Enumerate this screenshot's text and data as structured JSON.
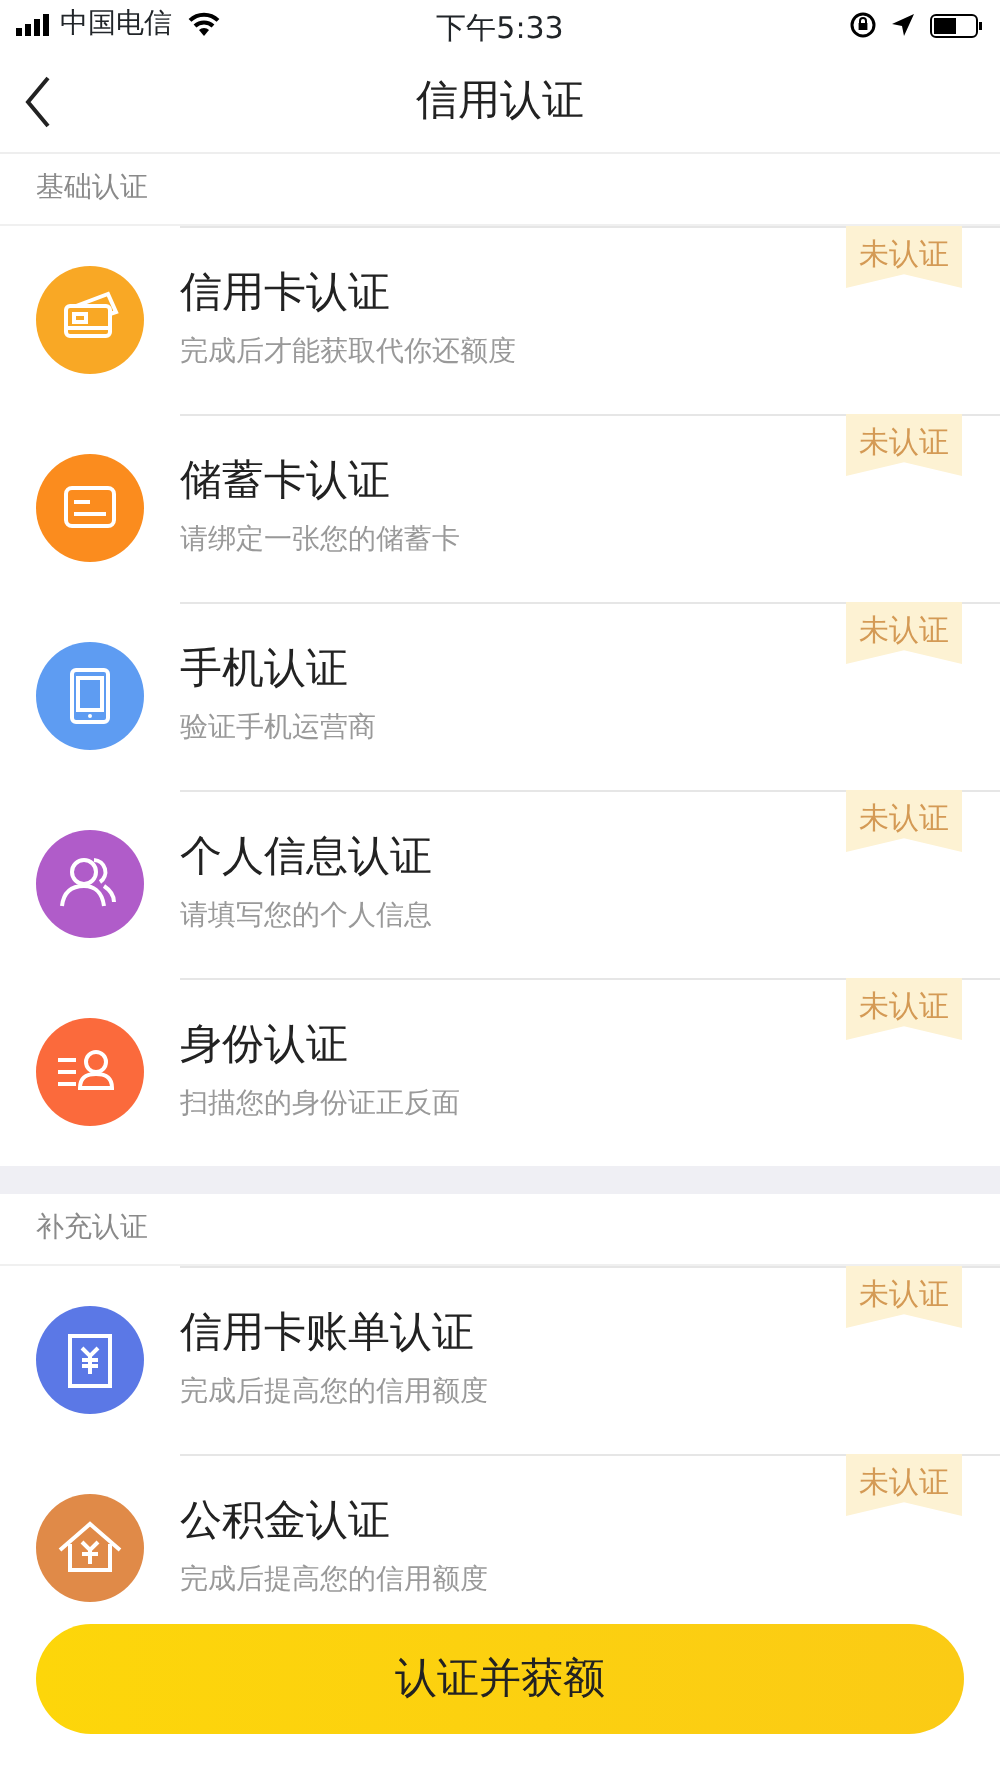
{
  "status_bar": {
    "carrier": "中国电信",
    "time": "下午5:33"
  },
  "nav": {
    "title": "信用认证"
  },
  "sections": [
    {
      "title": "基础认证",
      "items": [
        {
          "title": "信用卡认证",
          "subtitle": "完成后才能获取代你还额度",
          "badge": "未认证",
          "color": "#f9a825"
        },
        {
          "title": "储蓄卡认证",
          "subtitle": "请绑定一张您的储蓄卡",
          "badge": "未认证",
          "color": "#fb8c1e"
        },
        {
          "title": "手机认证",
          "subtitle": "验证手机运营商",
          "badge": "未认证",
          "color": "#5e9cf2"
        },
        {
          "title": "个人信息认证",
          "subtitle": "请填写您的个人信息",
          "badge": "未认证",
          "color": "#b05cc9"
        },
        {
          "title": "身份认证",
          "subtitle": "扫描您的身份证正反面",
          "badge": "未认证",
          "color": "#fb6a3c"
        }
      ]
    },
    {
      "title": "补充认证",
      "items": [
        {
          "title": "信用卡账单认证",
          "subtitle": "完成后提高您的信用额度",
          "badge": "未认证",
          "color": "#5b78e6"
        },
        {
          "title": "公积金认证",
          "subtitle": "完成后提高您的信用额度",
          "badge": "未认证",
          "color": "#e08a48"
        }
      ]
    }
  ],
  "button": "认证并获额"
}
